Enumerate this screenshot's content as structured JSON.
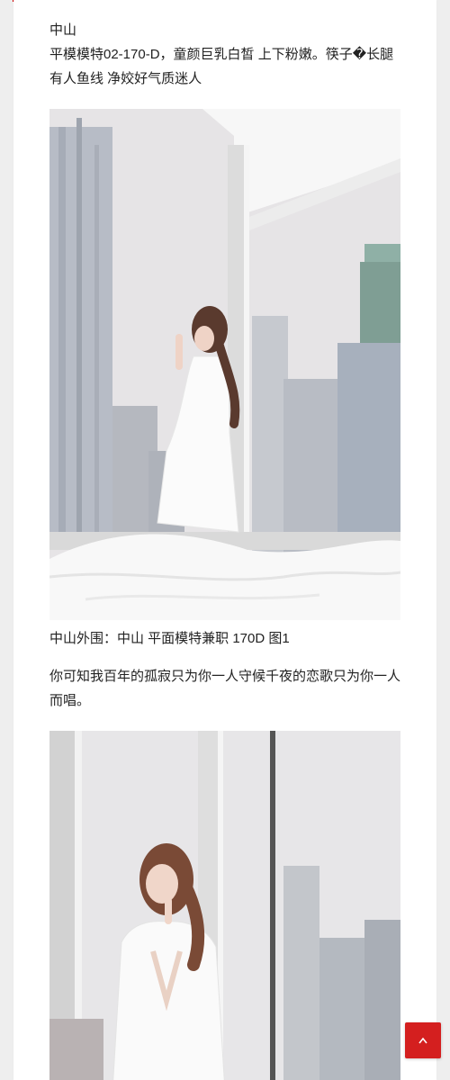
{
  "article": {
    "location": "中山",
    "description": "平模模特02-170-D，童颜巨乳白皙 上下粉嫩。筷子�长腿 有人鱼线 净姣好气质迷人",
    "photo_1_caption": "中山外围：中山 平面模特兼职 170D 图1",
    "poem": "你可知我百年的孤寂只为你一人守候千夜的恋歌只为你一人而唱。"
  },
  "colors": {
    "accent": "#d41f1f",
    "page_background": "#eeeeee",
    "card_background": "#ffffff"
  },
  "icons": {
    "scroll_top": "chevron-up-icon"
  }
}
